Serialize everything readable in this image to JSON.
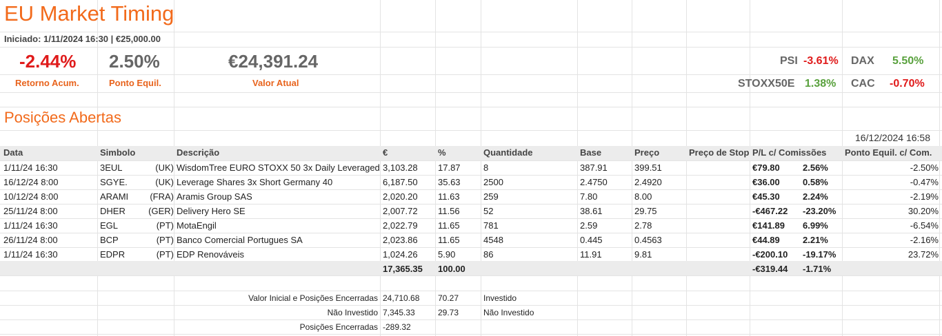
{
  "header": {
    "title": "EU Market Timing",
    "subtitle": "Iniciado: 1/11/2024 16:30 |  €25,000.00"
  },
  "summary": {
    "retorno_value": "-2.44%",
    "retorno_label": "Retorno Acum.",
    "equil_value": "2.50%",
    "equil_label": "Ponto Equil.",
    "valor_value": "€24,391.24",
    "valor_label": "Valor Atual"
  },
  "indices": [
    {
      "name": "PSI",
      "value": "-3.61%",
      "color": "#e01b1b"
    },
    {
      "name": "DAX",
      "value": "5.50%",
      "color": "#59a13d"
    },
    {
      "name": "STOXX50E",
      "value": "1.38%",
      "color": "#59a13d"
    },
    {
      "name": "CAC",
      "value": "-0.70%",
      "color": "#e01b1b"
    }
  ],
  "positions": {
    "title": "Posições Abertas",
    "timestamp": "16/12/2024 16:58",
    "columns": [
      "Data",
      "Simbolo",
      "Descrição",
      "€",
      "%",
      "Quantidade",
      "Base",
      "Preço",
      "Preço de Stop",
      "P/L c/ Comissões",
      "Ponto Equil. c/ Com."
    ],
    "rows": [
      {
        "data": "1/11/24 16:30",
        "simbolo": "3EUL",
        "mkt": "(UK)",
        "desc": "WisdomTree EURO STOXX 50 3x Daily Leveraged",
        "eur": "3,103.28",
        "pct": "17.87",
        "qty": "8",
        "base": "387.91",
        "preco": "399.51",
        "stop": "",
        "pl": "€79.80",
        "plpct": "2.56%",
        "equil": "-2.50%",
        "pos": true
      },
      {
        "data": "16/12/24 8:00",
        "simbolo": "SGYE.",
        "mkt": "(UK)",
        "desc": "Leverage Shares 3x Short Germany 40",
        "eur": "6,187.50",
        "pct": "35.63",
        "qty": "2500",
        "base": "2.4750",
        "preco": "2.4920",
        "stop": "",
        "pl": "€36.00",
        "plpct": "0.58%",
        "equil": "-0.47%",
        "pos": true
      },
      {
        "data": "10/12/24 8:00",
        "simbolo": "ARAMI",
        "mkt": "(FRA)",
        "desc": "Aramis Group SAS",
        "eur": "2,020.20",
        "pct": "11.63",
        "qty": "259",
        "base": "7.80",
        "preco": "8.00",
        "stop": "",
        "pl": "€45.30",
        "plpct": "2.24%",
        "equil": "-2.19%",
        "pos": true
      },
      {
        "data": "25/11/24 8:00",
        "simbolo": "DHER",
        "mkt": "(GER)",
        "desc": "Delivery Hero SE",
        "eur": "2,007.72",
        "pct": "11.56",
        "qty": "52",
        "base": "38.61",
        "preco": "29.75",
        "stop": "",
        "pl": "-€467.22",
        "plpct": "-23.20%",
        "equil": "30.20%",
        "pos": false
      },
      {
        "data": "1/11/24 16:30",
        "simbolo": "EGL",
        "mkt": "(PT)",
        "desc": "MotaEngil",
        "eur": "2,022.79",
        "pct": "11.65",
        "qty": "781",
        "base": "2.59",
        "preco": "2.78",
        "stop": "",
        "pl": "€141.89",
        "plpct": "6.99%",
        "equil": "-6.54%",
        "pos": true
      },
      {
        "data": "26/11/24 8:00",
        "simbolo": "BCP",
        "mkt": "(PT)",
        "desc": "Banco Comercial Portugues SA",
        "eur": "2,023.86",
        "pct": "11.65",
        "qty": "4548",
        "base": "0.445",
        "preco": "0.4563",
        "stop": "",
        "pl": "€44.89",
        "plpct": "2.21%",
        "equil": "-2.16%",
        "pos": true
      },
      {
        "data": "1/11/24 16:30",
        "simbolo": "EDPR",
        "mkt": "(PT)",
        "desc": "EDP Renováveis",
        "eur": "1,024.26",
        "pct": "5.90",
        "qty": "86",
        "base": "11.91",
        "preco": "9.81",
        "stop": "",
        "pl": "-€200.10",
        "plpct": "-19.17%",
        "equil": "23.72%",
        "pos": false
      }
    ],
    "total": {
      "eur": "17,365.35",
      "pct": "100.00",
      "pl": "-€319.44",
      "plpct": "-1.71%"
    }
  },
  "footer": [
    {
      "label": "Valor Inicial e Posições Encerradas",
      "value": "24,710.68",
      "pct": "70.27",
      "note": "Investido"
    },
    {
      "label": "Não Investido",
      "value": "7,345.33",
      "pct": "29.73",
      "note": "Não Investido"
    },
    {
      "label": "Posições Encerradas",
      "value": "-289.32",
      "pct": "",
      "note": ""
    }
  ]
}
